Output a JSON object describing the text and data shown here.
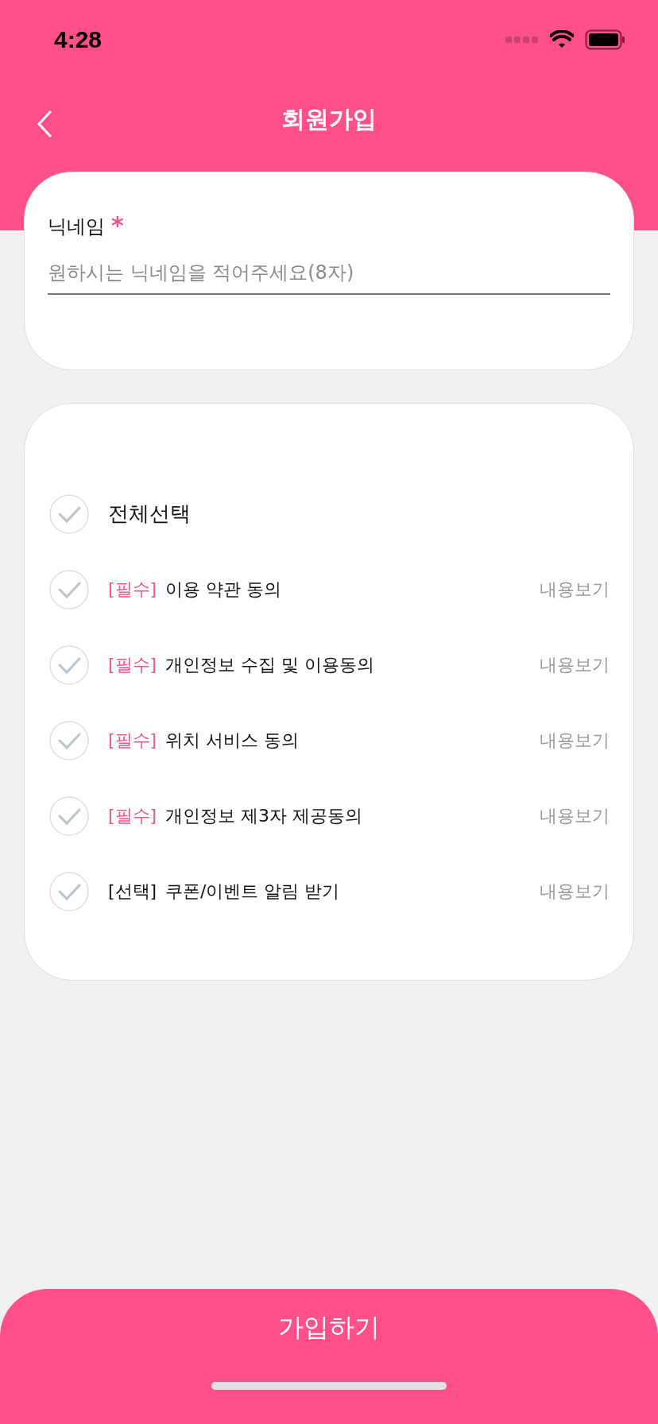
{
  "status_bar": {
    "time": "4:28"
  },
  "header": {
    "title": "회원가입"
  },
  "nickname": {
    "label": "닉네임",
    "required_mark": "*",
    "placeholder": "원하시는 닉네임을 적어주세요(8자)"
  },
  "terms": {
    "select_all": {
      "label": "전체선택",
      "checked": false
    },
    "items": [
      {
        "tag": "[필수]",
        "kind": "required",
        "label": "이용 약관 동의",
        "link": "내용보기",
        "checked": false
      },
      {
        "tag": "[필수]",
        "kind": "required",
        "label": "개인정보 수집 및 이용동의",
        "link": "내용보기",
        "checked": false
      },
      {
        "tag": "[필수]",
        "kind": "required",
        "label": "위치 서비스 동의",
        "link": "내용보기",
        "checked": false
      },
      {
        "tag": "[필수]",
        "kind": "required",
        "label": "개인정보 제3자 제공동의",
        "link": "내용보기",
        "checked": false
      },
      {
        "tag": "[선택]",
        "kind": "optional",
        "label": "쿠폰/이벤트 알림 받기",
        "link": "내용보기",
        "checked": false
      }
    ]
  },
  "submit": {
    "label": "가입하기"
  }
}
